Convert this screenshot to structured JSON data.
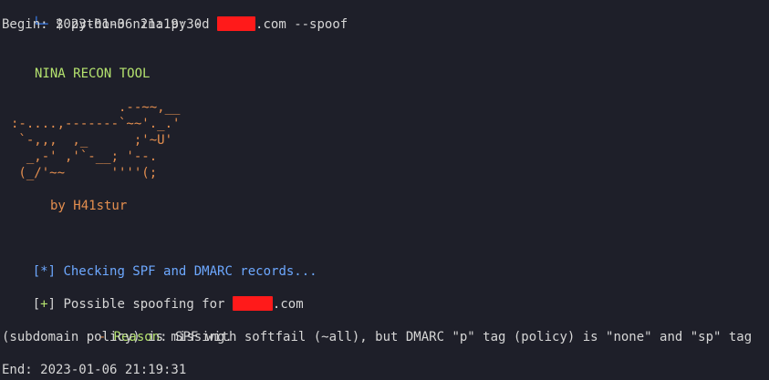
{
  "terminal": {
    "prompt_arrow": "└─",
    "prompt_symbol": "$",
    "command_pre": "python3 nina.py -d ",
    "command_post": ".com --spoof",
    "begin": "Begin: 2023-01-06 21:19:30",
    "tool_name": "NINA RECON TOOL",
    "ascii_art": [
      "              .--~~,__",
      ":-....,-------`~~'._.'",
      " `-,,,  ,_      ;'~U'",
      "  _,-' ,'`-__; '--.",
      " (_/'~~      ''''(;"
    ],
    "author": "by H41stur",
    "check_bracket": "[*]",
    "check_text": " Checking SPF and DMARC records...",
    "result_bracket": "[+]",
    "result_pre": " Possible spoofing for ",
    "result_post": ".com",
    "reason_dash": "- ",
    "reason_label": "Reason",
    "reason_text": ": SPF with softfail (~all), but DMARC \"p\" tag (policy) is \"none\" and \"sp\" tag",
    "reason_cont": "(subdomain policy) is missing.",
    "end": "End: 2023-01-06 21:19:31"
  },
  "colors": {
    "background": "#1e1f29",
    "green": "#b5e36f",
    "orange": "#e58f4f",
    "blue": "#6da8ff",
    "redaction": "#ff1a1a"
  }
}
